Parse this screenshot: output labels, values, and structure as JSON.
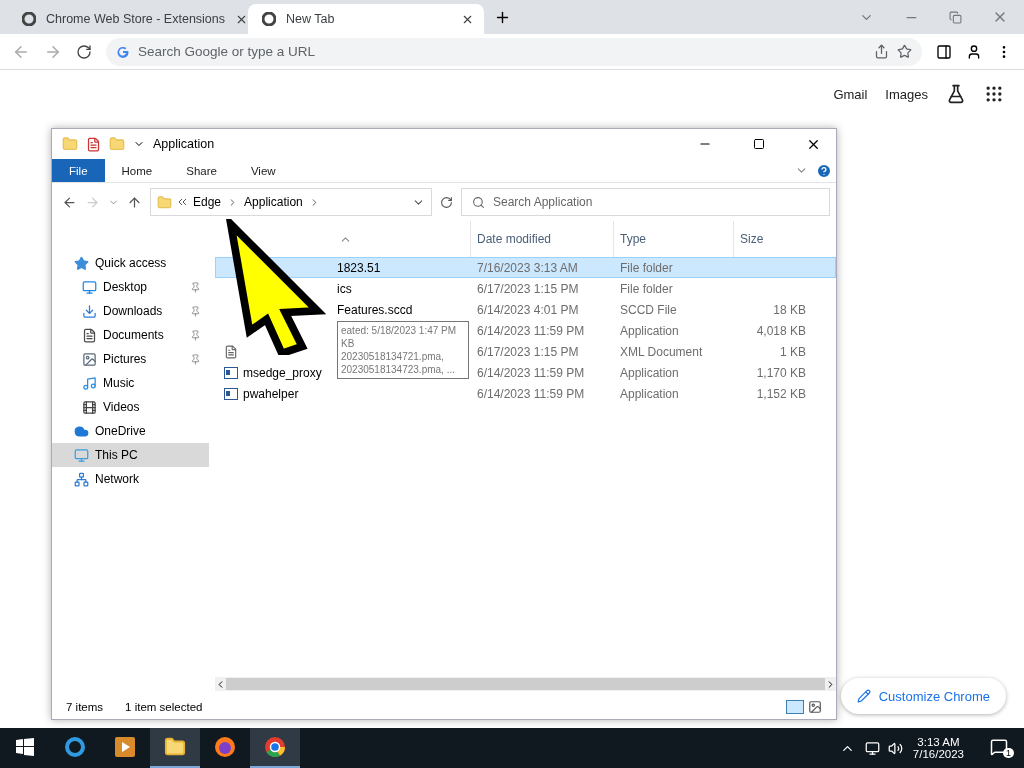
{
  "browser": {
    "tabs": [
      {
        "title": "Chrome Web Store - Extensions",
        "selected": false
      },
      {
        "title": "New Tab",
        "selected": true
      }
    ],
    "omnibox": {
      "placeholder": "Search Google or type a URL"
    },
    "links": [
      "Gmail",
      "Images"
    ],
    "customize_button": "Customize Chrome"
  },
  "explorer": {
    "title": "Application",
    "ribbon_tabs": [
      {
        "label": "File",
        "selected": true
      },
      {
        "label": "Home",
        "selected": false
      },
      {
        "label": "Share",
        "selected": false
      },
      {
        "label": "View",
        "selected": false
      }
    ],
    "breadcrumb": [
      "Edge",
      "Application"
    ],
    "search": {
      "placeholder": "Search Application"
    },
    "nav": [
      {
        "label": "Quick access",
        "kind": "star",
        "pinned": false,
        "selected": false,
        "children": [
          {
            "label": "Desktop",
            "kind": "desktop",
            "pinned": true,
            "selected": false
          },
          {
            "label": "Downloads",
            "kind": "download",
            "pinned": true,
            "selected": false
          },
          {
            "label": "Documents",
            "kind": "document",
            "pinned": true,
            "selected": false
          },
          {
            "label": "Pictures",
            "kind": "picture",
            "pinned": true,
            "selected": false
          },
          {
            "label": "Music",
            "kind": "music",
            "pinned": false,
            "selected": false
          },
          {
            "label": "Videos",
            "kind": "video",
            "pinned": false,
            "selected": false
          }
        ]
      },
      {
        "label": "OneDrive",
        "kind": "cloud",
        "pinned": false,
        "selected": false
      },
      {
        "label": "This PC",
        "kind": "pc",
        "pinned": false,
        "selected": true
      },
      {
        "label": "Network",
        "kind": "network",
        "pinned": false,
        "selected": false
      }
    ],
    "columns": [
      "Date modified",
      "Type",
      "Size"
    ],
    "rows": [
      {
        "name": "1823.51",
        "kind": "none",
        "date": "7/16/2023 3:13 AM",
        "type": "File folder",
        "size": "",
        "selected": true
      },
      {
        "name": "ics",
        "kind": "none",
        "date": "6/17/2023 1:15 PM",
        "type": "File folder",
        "size": "",
        "selected": false
      },
      {
        "name": "Features.sccd",
        "kind": "none",
        "date": "6/14/2023 4:01 PM",
        "type": "SCCD File",
        "size": "18 KB",
        "selected": false
      },
      {
        "name": "",
        "kind": "none",
        "date": "6/14/2023 11:59 PM",
        "type": "Application",
        "size": "4,018 KB",
        "selected": false
      },
      {
        "name": "",
        "kind": "xml",
        "date": "6/17/2023 1:15 PM",
        "type": "XML Document",
        "size": "1 KB",
        "selected": false
      },
      {
        "name": "msedge_proxy",
        "kind": "app",
        "date": "6/14/2023 11:59 PM",
        "type": "Application",
        "size": "1,170 KB",
        "selected": false
      },
      {
        "name": "pwahelper",
        "kind": "app",
        "date": "6/14/2023 11:59 PM",
        "type": "Application",
        "size": "1,152 KB",
        "selected": false
      }
    ],
    "tooltip": [
      "eated: 5/18/2023 1:47 PM",
      "KB",
      "20230518134721.pma, 20230518134723.pma, ..."
    ],
    "status": [
      "7 items",
      "1 item selected"
    ]
  },
  "taskbar": {
    "time": "3:13 AM",
    "date": "7/16/2023",
    "notifications": "1"
  }
}
